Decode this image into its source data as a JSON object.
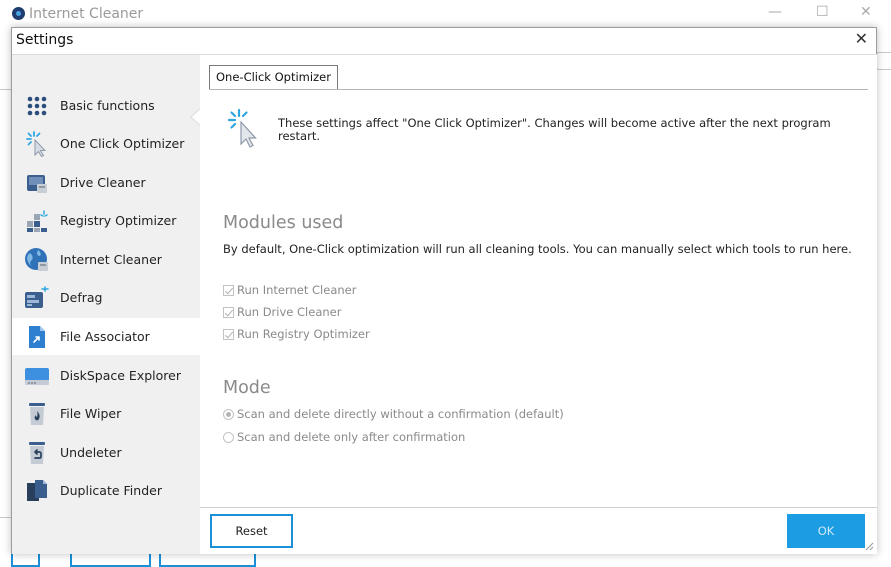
{
  "window": {
    "app_title": "Internet Cleaner",
    "minimize": "—",
    "maximize": "☐",
    "close": "✕"
  },
  "dialog": {
    "title": "Settings",
    "close": "✕"
  },
  "sidebar": {
    "items": [
      {
        "label": "Basic functions",
        "icon": "grid-dots-icon",
        "active": false
      },
      {
        "label": "One Click Optimizer",
        "icon": "optimizer-cursor-icon",
        "active": false
      },
      {
        "label": "Drive Cleaner",
        "icon": "drive-cleaner-icon",
        "active": false
      },
      {
        "label": "Registry Optimizer",
        "icon": "registry-optimizer-icon",
        "active": false
      },
      {
        "label": "Internet Cleaner",
        "icon": "globe-icon",
        "active": false
      },
      {
        "label": "Defrag",
        "icon": "defrag-icon",
        "active": false
      },
      {
        "label": "File Associator",
        "icon": "file-associator-icon",
        "active": true
      },
      {
        "label": "DiskSpace Explorer",
        "icon": "disk-icon",
        "active": false
      },
      {
        "label": "File Wiper",
        "icon": "file-wiper-icon",
        "active": false
      },
      {
        "label": "Undeleter",
        "icon": "undeleter-icon",
        "active": false
      },
      {
        "label": "Duplicate Finder",
        "icon": "duplicate-finder-icon",
        "active": false
      }
    ]
  },
  "main": {
    "tab_label": "One-Click Optimizer",
    "info_text": "These settings affect \"One Click Optimizer\". Changes will become active after the next program restart.",
    "modules": {
      "heading": "Modules used",
      "description": "By default, One-Click optimization will run all cleaning tools. You can manually select which tools to run here.",
      "options": [
        {
          "label": "Run Internet Cleaner",
          "checked": true
        },
        {
          "label": "Run Drive Cleaner",
          "checked": true
        },
        {
          "label": "Run Registry Optimizer",
          "checked": true
        }
      ]
    },
    "mode": {
      "heading": "Mode",
      "options": [
        {
          "label": "Scan and delete directly without a confirmation (default)",
          "selected": true
        },
        {
          "label": "Scan and delete only after confirmation",
          "selected": false
        }
      ]
    }
  },
  "footer": {
    "reset_label": "Reset",
    "ok_label": "OK"
  },
  "colors": {
    "accent": "#1b9ce3",
    "sidebar_bg": "#f0f0f0",
    "disabled_text": "#8a8a8a"
  }
}
